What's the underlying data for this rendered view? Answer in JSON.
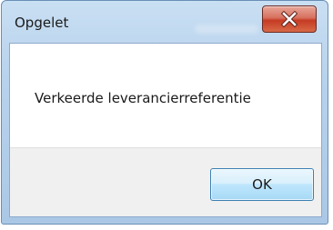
{
  "window": {
    "title": "Opgelet"
  },
  "message": {
    "text": "Verkeerde leverancierreferentie"
  },
  "buttons": {
    "ok_label": "OK"
  },
  "icons": {
    "close": "close-icon"
  },
  "colors": {
    "close_button": "#c53b23",
    "ok_button_border": "#3c7fb1"
  }
}
